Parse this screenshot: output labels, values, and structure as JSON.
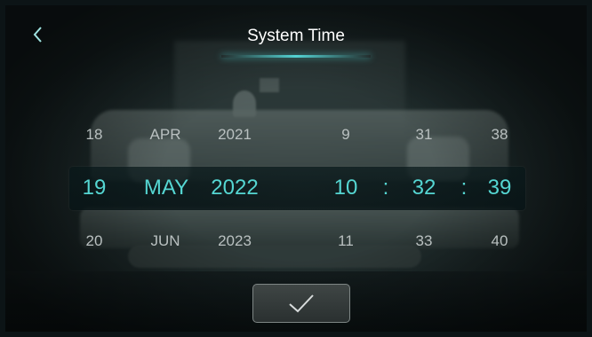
{
  "header": {
    "title": "System Time",
    "back_icon": "chevron-left-icon"
  },
  "picker": {
    "columns": [
      "day",
      "month",
      "year",
      "hour",
      "minute",
      "second"
    ],
    "previous": {
      "day": "18",
      "month": "APR",
      "year": "2021",
      "hour": "9",
      "minute": "31",
      "second": "38"
    },
    "selected": {
      "day": "19",
      "month": "MAY",
      "year": "2022",
      "hour": "10",
      "minute": "32",
      "second": "39"
    },
    "next": {
      "day": "20",
      "month": "JUN",
      "year": "2023",
      "hour": "11",
      "minute": "33",
      "second": "40"
    },
    "separator": ":"
  },
  "confirm": {
    "icon": "checkmark-icon"
  },
  "colors": {
    "accent": "#55d6d2",
    "title": "#ffffff",
    "muted": "#b9c0c0"
  }
}
